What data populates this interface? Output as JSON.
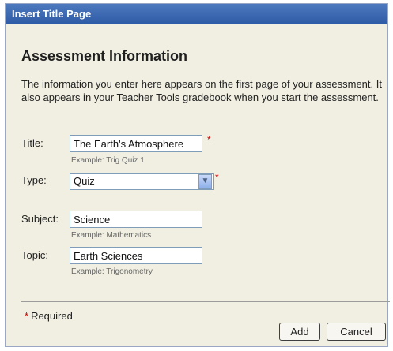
{
  "dialog": {
    "title": "Insert Title Page",
    "heading": "Assessment Information",
    "description": "The information you enter here appears on the first page of your assessment. It also appears in your Teacher Tools gradebook when you start the assessment."
  },
  "form": {
    "title": {
      "label": "Title:",
      "value": "The Earth's Atmosphere",
      "example": "Example: Trig Quiz 1",
      "required_marker": "*"
    },
    "type": {
      "label": "Type:",
      "value": "Quiz",
      "required_marker": "*"
    },
    "subject": {
      "label": "Subject:",
      "value": "Science",
      "example": "Example: Mathematics"
    },
    "topic": {
      "label": "Topic:",
      "value": "Earth Sciences",
      "example": "Example: Trigonometry"
    }
  },
  "footer": {
    "required_star": "*",
    "required_text": "Required",
    "add_label": "Add",
    "cancel_label": "Cancel"
  },
  "icons": {
    "dropdown": "chevron-down-icon"
  },
  "colors": {
    "titlebar": "#3366b3",
    "background": "#f1efe2",
    "required": "#cc0000",
    "input_border": "#7f9db9"
  }
}
